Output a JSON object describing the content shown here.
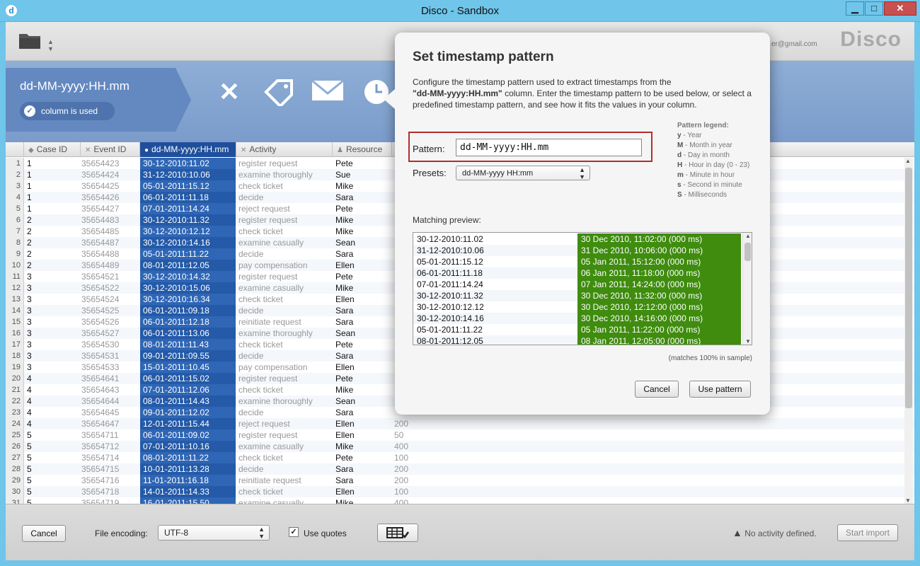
{
  "window": {
    "title": "Disco - Sandbox",
    "app_icon": "d",
    "min": "▁",
    "max": "□",
    "close": "✕"
  },
  "header": {
    "logo": "Disco",
    "email": "er@gmail.com"
  },
  "band": {
    "column_title": "dd-MM-yyyy:HH.mm",
    "column_used": "column is used",
    "icons": [
      "remove-icon",
      "tag-icon",
      "mail-icon",
      "clock-icon"
    ]
  },
  "table": {
    "columns": [
      {
        "label": "Case ID",
        "icon": "tag-icon"
      },
      {
        "label": "Event ID",
        "icon": "remove-icon"
      },
      {
        "label": "dd-MM-yyyy:HH.mm",
        "icon": "clock-icon"
      },
      {
        "label": "Activity",
        "icon": "remove-icon"
      },
      {
        "label": "Resource",
        "icon": "resource-icon"
      }
    ],
    "rows": [
      {
        "n": "1",
        "case": "1",
        "event": "35654423",
        "ts": "30-12-2010:11.02",
        "act": "register request",
        "res": "Pete",
        "cost": ""
      },
      {
        "n": "2",
        "case": "1",
        "event": "35654424",
        "ts": "31-12-2010:10.06",
        "act": "examine thoroughly",
        "res": "Sue",
        "cost": ""
      },
      {
        "n": "3",
        "case": "1",
        "event": "35654425",
        "ts": "05-01-2011:15.12",
        "act": "check ticket",
        "res": "Mike",
        "cost": ""
      },
      {
        "n": "4",
        "case": "1",
        "event": "35654426",
        "ts": "06-01-2011:11.18",
        "act": "decide",
        "res": "Sara",
        "cost": ""
      },
      {
        "n": "5",
        "case": "1",
        "event": "35654427",
        "ts": "07-01-2011:14.24",
        "act": "reject request",
        "res": "Pete",
        "cost": ""
      },
      {
        "n": "6",
        "case": "2",
        "event": "35654483",
        "ts": "30-12-2010:11.32",
        "act": "register request",
        "res": "Mike",
        "cost": ""
      },
      {
        "n": "7",
        "case": "2",
        "event": "35654485",
        "ts": "30-12-2010:12.12",
        "act": "check ticket",
        "res": "Mike",
        "cost": ""
      },
      {
        "n": "8",
        "case": "2",
        "event": "35654487",
        "ts": "30-12-2010:14.16",
        "act": "examine casually",
        "res": "Sean",
        "cost": ""
      },
      {
        "n": "9",
        "case": "2",
        "event": "35654488",
        "ts": "05-01-2011:11.22",
        "act": "decide",
        "res": "Sara",
        "cost": ""
      },
      {
        "n": "10",
        "case": "2",
        "event": "35654489",
        "ts": "08-01-2011:12.05",
        "act": "pay compensation",
        "res": "Ellen",
        "cost": ""
      },
      {
        "n": "11",
        "case": "3",
        "event": "35654521",
        "ts": "30-12-2010:14.32",
        "act": "register request",
        "res": "Pete",
        "cost": ""
      },
      {
        "n": "12",
        "case": "3",
        "event": "35654522",
        "ts": "30-12-2010:15.06",
        "act": "examine casually",
        "res": "Mike",
        "cost": ""
      },
      {
        "n": "13",
        "case": "3",
        "event": "35654524",
        "ts": "30-12-2010:16.34",
        "act": "check ticket",
        "res": "Ellen",
        "cost": ""
      },
      {
        "n": "14",
        "case": "3",
        "event": "35654525",
        "ts": "06-01-2011:09.18",
        "act": "decide",
        "res": "Sara",
        "cost": ""
      },
      {
        "n": "15",
        "case": "3",
        "event": "35654526",
        "ts": "06-01-2011:12.18",
        "act": "reinitiate request",
        "res": "Sara",
        "cost": ""
      },
      {
        "n": "16",
        "case": "3",
        "event": "35654527",
        "ts": "06-01-2011:13.06",
        "act": "examine thoroughly",
        "res": "Sean",
        "cost": ""
      },
      {
        "n": "17",
        "case": "3",
        "event": "35654530",
        "ts": "08-01-2011:11.43",
        "act": "check ticket",
        "res": "Pete",
        "cost": ""
      },
      {
        "n": "18",
        "case": "3",
        "event": "35654531",
        "ts": "09-01-2011:09.55",
        "act": "decide",
        "res": "Sara",
        "cost": ""
      },
      {
        "n": "19",
        "case": "3",
        "event": "35654533",
        "ts": "15-01-2011:10.45",
        "act": "pay compensation",
        "res": "Ellen",
        "cost": ""
      },
      {
        "n": "20",
        "case": "4",
        "event": "35654641",
        "ts": "06-01-2011:15.02",
        "act": "register request",
        "res": "Pete",
        "cost": ""
      },
      {
        "n": "21",
        "case": "4",
        "event": "35654643",
        "ts": "07-01-2011:12.06",
        "act": "check ticket",
        "res": "Mike",
        "cost": ""
      },
      {
        "n": "22",
        "case": "4",
        "event": "35654644",
        "ts": "08-01-2011:14.43",
        "act": "examine thoroughly",
        "res": "Sean",
        "cost": ""
      },
      {
        "n": "23",
        "case": "4",
        "event": "35654645",
        "ts": "09-01-2011:12.02",
        "act": "decide",
        "res": "Sara",
        "cost": ""
      },
      {
        "n": "24",
        "case": "4",
        "event": "35654647",
        "ts": "12-01-2011:15.44",
        "act": "reject request",
        "res": "Ellen",
        "cost": "200"
      },
      {
        "n": "25",
        "case": "5",
        "event": "35654711",
        "ts": "06-01-2011:09.02",
        "act": "register request",
        "res": "Ellen",
        "cost": "50"
      },
      {
        "n": "26",
        "case": "5",
        "event": "35654712",
        "ts": "07-01-2011:10.16",
        "act": "examine casually",
        "res": "Mike",
        "cost": "400"
      },
      {
        "n": "27",
        "case": "5",
        "event": "35654714",
        "ts": "08-01-2011:11.22",
        "act": "check ticket",
        "res": "Pete",
        "cost": "100"
      },
      {
        "n": "28",
        "case": "5",
        "event": "35654715",
        "ts": "10-01-2011:13.28",
        "act": "decide",
        "res": "Sara",
        "cost": "200"
      },
      {
        "n": "29",
        "case": "5",
        "event": "35654716",
        "ts": "11-01-2011:16.18",
        "act": "reinitiate request",
        "res": "Sara",
        "cost": "200"
      },
      {
        "n": "30",
        "case": "5",
        "event": "35654718",
        "ts": "14-01-2011:14.33",
        "act": "check ticket",
        "res": "Ellen",
        "cost": "100"
      },
      {
        "n": "31",
        "case": "5",
        "event": "35654719",
        "ts": "16-01-2011:15.50",
        "act": "examine casually",
        "res": "Mike",
        "cost": "400"
      }
    ]
  },
  "bottom": {
    "cancel": "Cancel",
    "file_encoding_label": "File encoding:",
    "encoding_value": "UTF-8",
    "use_quotes_label": "Use quotes",
    "use_quotes_checked": true,
    "warning": "No activity defined.",
    "start_import": "Start import"
  },
  "dialog": {
    "title": "Set timestamp pattern",
    "desc_1": "Configure the timestamp pattern used to extract timestamps from the",
    "desc_col": "\"dd-MM-yyyy:HH.mm\"",
    "desc_2": " column. Enter the timestamp pattern to be used below, or select a predefined timestamp pattern, and see how it fits the values in your column.",
    "pattern_label": "Pattern:",
    "pattern_value": "dd-MM-yyyy:HH.mm",
    "presets_label": "Presets:",
    "presets_value": "dd-MM-yyyy HH:mm",
    "legend": {
      "title": "Pattern legend:",
      "items": [
        {
          "k": "y",
          "v": " - Year"
        },
        {
          "k": "M",
          "v": " - Month in year"
        },
        {
          "k": "d",
          "v": " - Day in month"
        },
        {
          "k": "H",
          "v": " - Hour in day (0 - 23)"
        },
        {
          "k": "m",
          "v": " - Minute in hour"
        },
        {
          "k": "s",
          "v": " - Second in minute"
        },
        {
          "k": "S",
          "v": " - Milliseconds"
        }
      ]
    },
    "preview_label": "Matching preview:",
    "preview": [
      {
        "in": "30-12-2010:11.02",
        "out": "30 Dec 2010, 11:02:00 (000 ms)"
      },
      {
        "in": "31-12-2010:10.06",
        "out": "31 Dec 2010, 10:06:00 (000 ms)"
      },
      {
        "in": "05-01-2011:15.12",
        "out": "05 Jan 2011, 15:12:00 (000 ms)"
      },
      {
        "in": "06-01-2011:11.18",
        "out": "06 Jan 2011, 11:18:00 (000 ms)"
      },
      {
        "in": "07-01-2011:14.24",
        "out": "07 Jan 2011, 14:24:00 (000 ms)"
      },
      {
        "in": "30-12-2010:11.32",
        "out": "30 Dec 2010, 11:32:00 (000 ms)"
      },
      {
        "in": "30-12-2010:12.12",
        "out": "30 Dec 2010, 12:12:00 (000 ms)"
      },
      {
        "in": "30-12-2010:14.16",
        "out": "30 Dec 2010, 14:16:00 (000 ms)"
      },
      {
        "in": "05-01-2011:11.22",
        "out": "05 Jan 2011, 11:22:00 (000 ms)"
      },
      {
        "in": "08-01-2011:12.05",
        "out": "08 Jan 2011, 12:05:00 (000 ms)"
      }
    ],
    "match_note": "(matches 100% in sample)",
    "cancel": "Cancel",
    "use_pattern": "Use pattern"
  }
}
